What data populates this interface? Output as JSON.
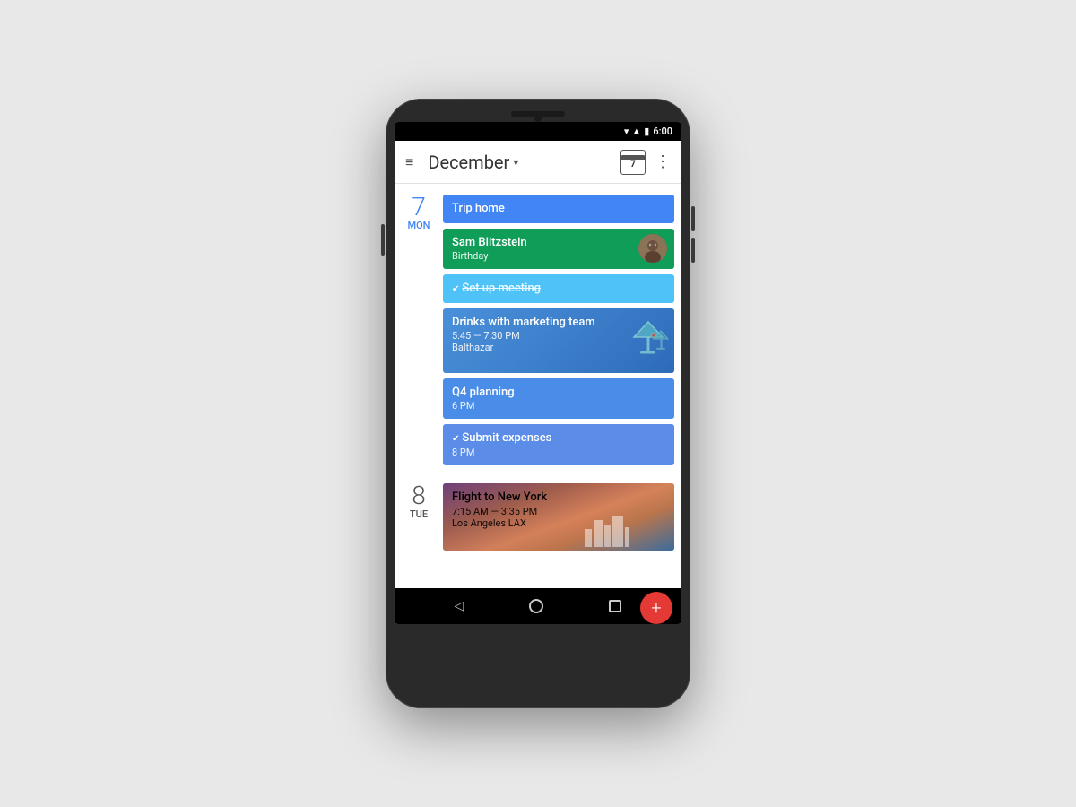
{
  "status_bar": {
    "time": "6:00",
    "icons": [
      "wifi",
      "signal",
      "battery"
    ]
  },
  "app_bar": {
    "menu_label": "≡",
    "title": "December",
    "dropdown_arrow": "▾",
    "calendar_day": "7",
    "more_icon": "⋮"
  },
  "days": [
    {
      "number": "7",
      "name": "Mon",
      "events": [
        {
          "id": "trip-home",
          "type": "event",
          "color": "blue",
          "title": "Trip home",
          "subtitle": null,
          "location": null,
          "time": null
        },
        {
          "id": "birthday",
          "type": "event",
          "color": "green",
          "title": "Sam Blitzstein",
          "subtitle": "Birthday",
          "location": null,
          "time": null,
          "has_avatar": true
        },
        {
          "id": "setup-meeting",
          "type": "task",
          "color": "teal-task",
          "title": "Set up meeting",
          "strikethrough": true,
          "task_icon": "✔"
        },
        {
          "id": "drinks",
          "type": "event",
          "color": "dark-blue",
          "title": "Drinks with marketing team",
          "subtitle": "5:45 — 7:30 PM",
          "location": "Balthazar",
          "has_cocktail": true
        },
        {
          "id": "q4-planning",
          "type": "event",
          "color": "medium-blue",
          "title": "Q4 planning",
          "subtitle": "6 PM",
          "location": null
        },
        {
          "id": "submit-expenses",
          "type": "task",
          "color": "task-blue",
          "title": "Submit expenses",
          "subtitle": "8 PM",
          "task_icon": "✔"
        }
      ]
    },
    {
      "number": "8",
      "name": "Tue",
      "events": [
        {
          "id": "flight-ny",
          "type": "event",
          "color": "flight",
          "title": "Flight to New York",
          "subtitle": "7:15 AM — 3:35 PM",
          "location": "Los Angeles LAX"
        }
      ]
    }
  ],
  "fab": {
    "label": "+"
  },
  "nav_bar": {
    "back": "◁",
    "home": "",
    "recent": ""
  }
}
